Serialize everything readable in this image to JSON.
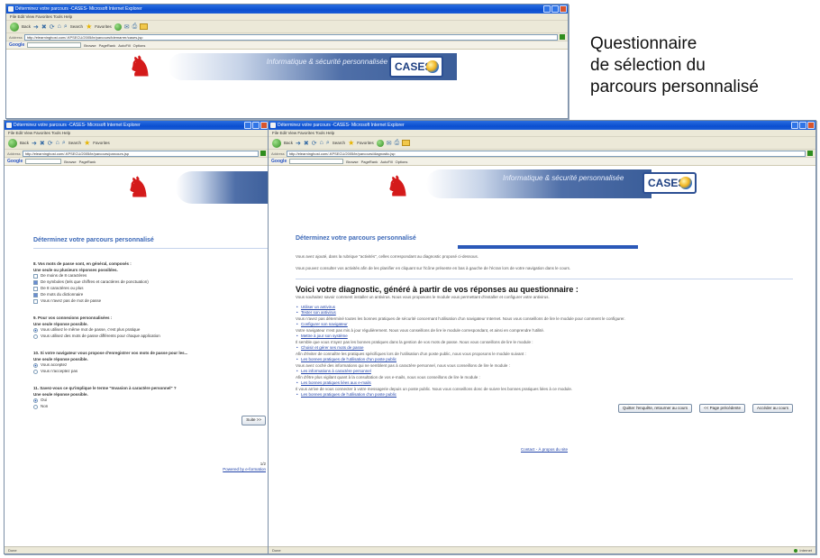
{
  "caption": {
    "lines": [
      "Questionnaire",
      "de sélection du",
      "parcours personnalisé"
    ]
  },
  "browser": {
    "top_title": "Déterminez votre parcours -CASES- Microsoft Internet Explorer",
    "left_title": "Déterminez votre parcours -CASES- Microsoft Internet Explorer",
    "right_title": "Déterminez votre parcours -CASES- Microsoft Internet Explorer",
    "menu": "File  Edit  View  Favorites  Tools  Help",
    "back_label": "Back",
    "search_label": "Search",
    "favorites_label": "Favorites",
    "address_label": "Address",
    "top_url": "http://elearninghost.com/-KPSECU/2005/ie/parcours/tdemarrer/cases.jsp",
    "left_url": "http://elearninghost.com/-KPSECU/2005/ie/parcours/parcours.jsp",
    "right_url": "http://elearninghost.com/-KPSECU/2005/ie/parcours/diagnostic.jsp",
    "google_label": "Google",
    "google_items": [
      "Browse",
      "PageRank",
      "AutoFill",
      "Options"
    ],
    "status_left": "Done",
    "status_right": "Internet"
  },
  "banner": {
    "tagline": "Informatique & sécurité personnalisée",
    "cases_logo": "CASES"
  },
  "left_page": {
    "heading": "Déterminez votre parcours personnalisé",
    "q1_title": "8. Vos mots de passe sont, en général, composés :",
    "q1_sub": "Une seule ou plusieurs réponses possibles.",
    "q1_options": [
      "De moins de 8 caractères",
      "De symboles (tels que chiffres et caractères de ponctuation)",
      "De 8 caractères ou plus",
      "De mots du dictionnaire",
      "Vous n'avez pas de mot de passe"
    ],
    "q2_title": "9. Pour vos connexions personnalisées :",
    "q2_sub": "Une seule réponse possible.",
    "q2_options": [
      "Vous utilisez le même mot de passe, c'est plus pratique",
      "Vous utilisez des mots de passe différents pour chaque application"
    ],
    "q3_title": "10. Si votre navigateur vous propose d'enregistrer vos mots de passe pour les...",
    "q3_sub": "Une seule réponse possible.",
    "q3_options": [
      "Vous acceptez",
      "Vous n'acceptez pas"
    ],
    "q4_title": "11. Savez-vous ce qu'implique le terme \"Invasion à caractère personnel\" ?",
    "q4_sub": "Une seule réponse possible.",
    "q4_options": [
      "Oui",
      "Non"
    ],
    "next_button": "Suite >>",
    "footer_link": "Powered by e-formation",
    "footer_small": "1/2"
  },
  "right_page": {
    "heading": "Déterminez votre parcours personnalisé",
    "intro1": "Vous avez ajouté, dans la rubrique \"activités\", celles correspondant au diagnostic proposé ci-dessous.",
    "intro2": "Vous pouvez consulter vos activités afin de les planifier en cliquant sur l'icône présente en bas à gauche de l'écran lors de votre navigation dans le cours.",
    "diag_title": "Voici votre diagnostic, généré à partir de vos réponses au questionnaire :",
    "diag_sub": "Vous souhaitez savoir comment installer un antivirus. Nous vous proposons le module vous permettant d'installer et configurer votre antivirus.",
    "items": [
      {
        "link": "Utiliser un antivirus",
        "text": ""
      },
      {
        "link": "Tester son antivirus",
        "text": "Vous n'avez pas déterminé toutes les bonnes pratiques de sécurité concernant l'utilisation d'un navigateur Internet. Nous vous conseillons de lire le module pour comment le configurer."
      },
      {
        "link": "Configurer son navigateur",
        "text": "Votre navigateur n'est pas mis à jour régulièrement. Nous vous conseillons de lire le module correspondant, et ainsi en comprendre l'utilité."
      },
      {
        "link": "Mettre à jour son système",
        "text": "Il semble que vous n'ayez pas les bonnes pratiques dans la gestion de vos mots de passe. Nous vous conseillons de lire le module :"
      },
      {
        "link": "Choisir et gérer ses mots de passe",
        "text": "Afin d'éviter de connaître les pratiques spécifiques lors de l'utilisation d'un poste public, nous vous proposons le module suivant :"
      },
      {
        "link": "Les bonnes pratiques de l'utilisation d'un poste public",
        "text": "Vous avez coché des informations qui ne semblent pas à caractère personnel, nous vous conseillons de lire le module :"
      },
      {
        "link": "Les informations à caractère personnel",
        "text": "Afin d'être plus vigilant quant à la consultation de vos e-mails, nous vous conseillons de lire le module :"
      },
      {
        "link": "Les bonnes pratiques liées aux e-mails",
        "text": "Il vous arrive de vous connecter à votre messagerie depuis un poste public. Nous vous conseillons donc de suivre les bonnes pratiques liées à ce module."
      },
      {
        "link": "Les bonnes pratiques de l'utilisation d'un poste public",
        "text": ""
      }
    ],
    "buttons": [
      "Quitter l'enquête, retourner au cours",
      "<< Page précédente",
      "Accéder au cours"
    ],
    "footer_link": "Contact - À propos du site"
  }
}
